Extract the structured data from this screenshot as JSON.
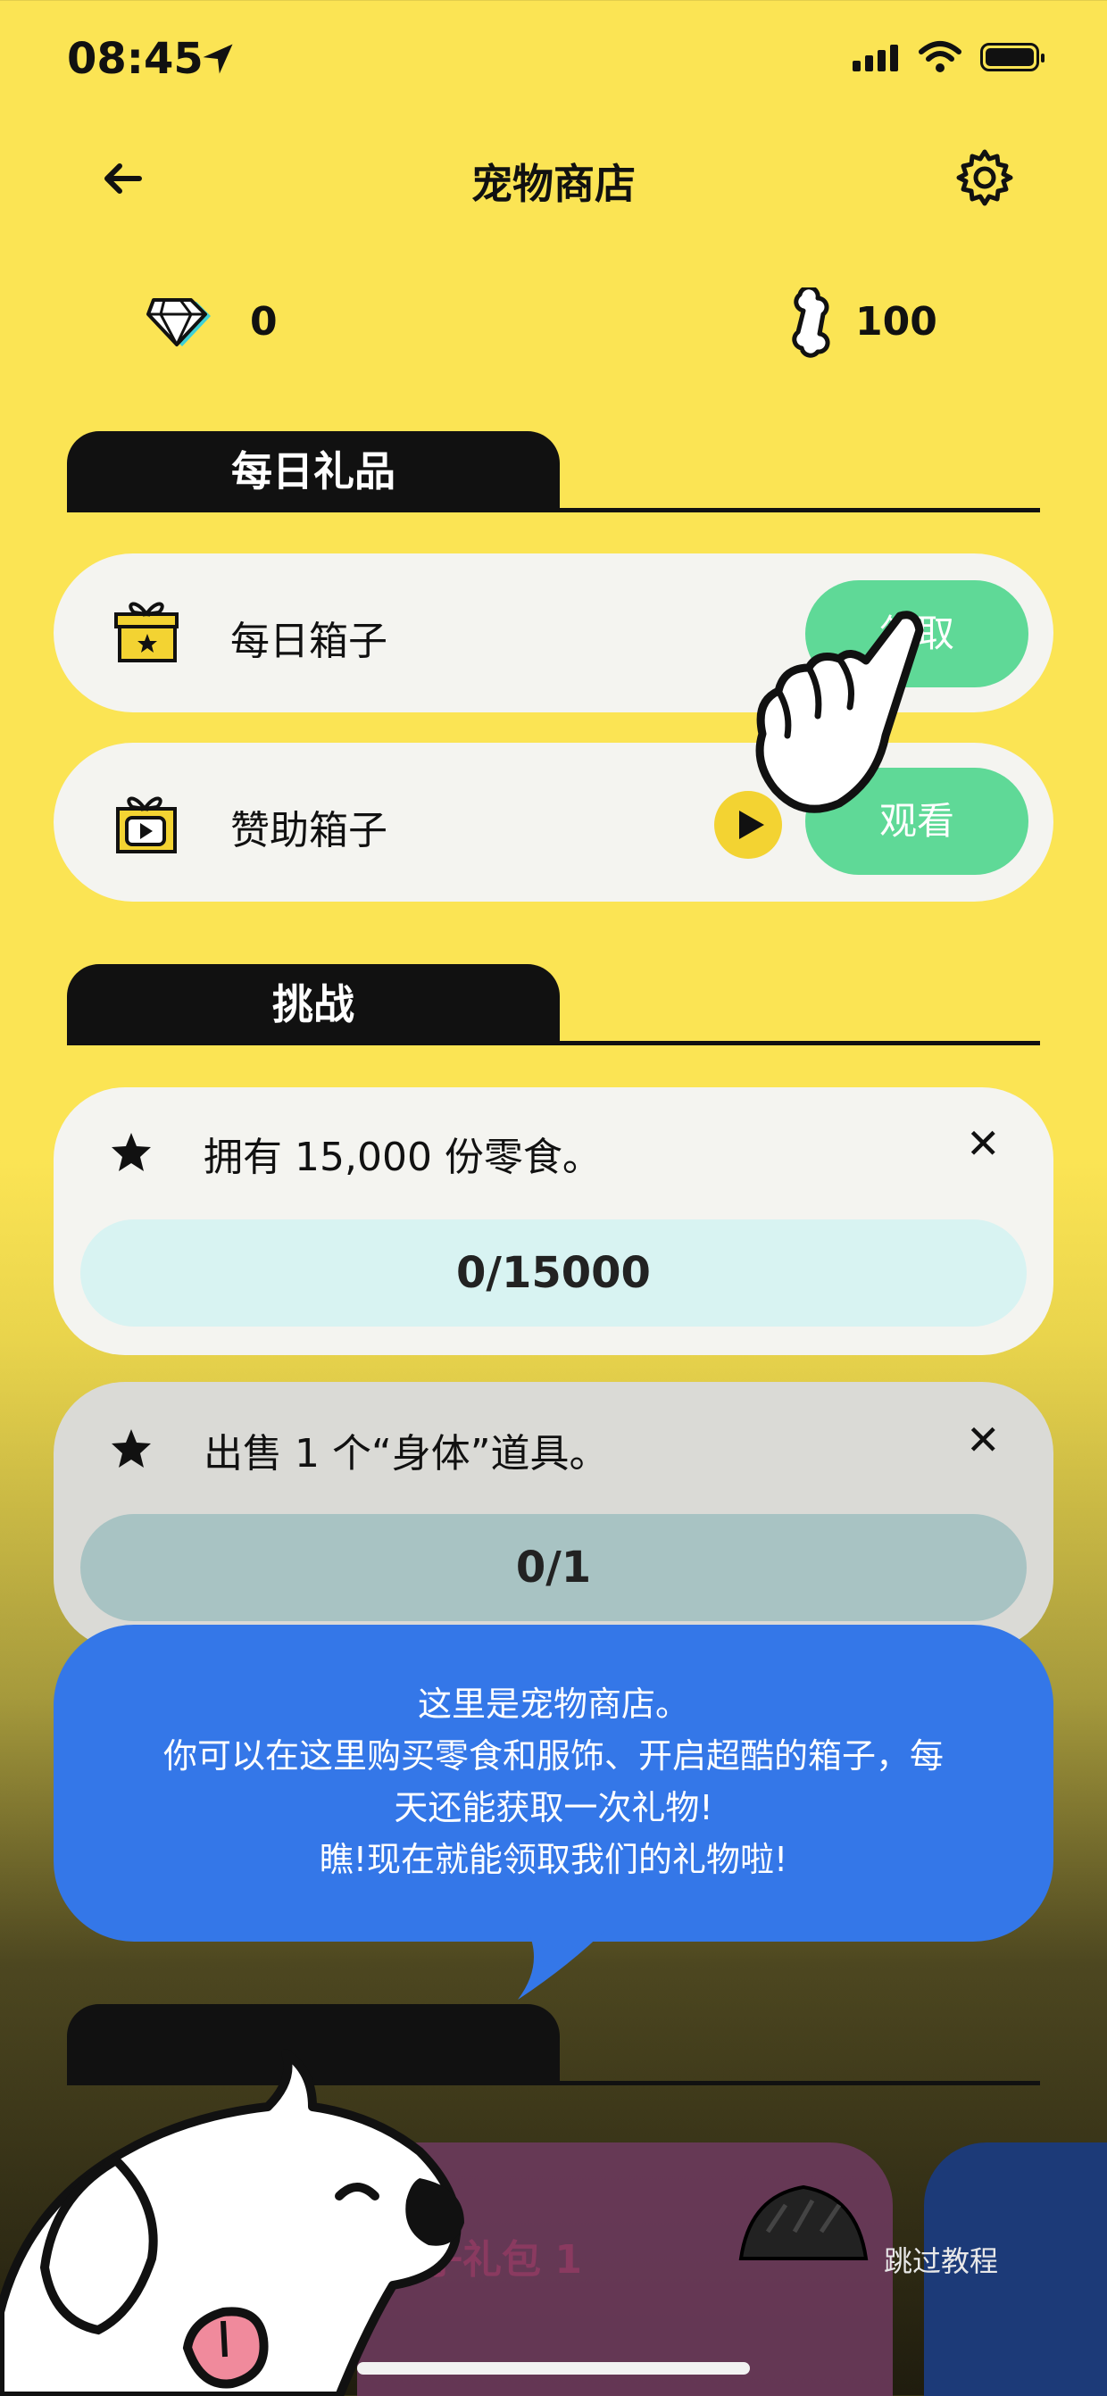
{
  "status_bar": {
    "time": "08:45"
  },
  "header": {
    "title": "宠物商店"
  },
  "currency": {
    "gems": "0",
    "bones": "100"
  },
  "daily_gifts": {
    "section_title": "每日礼品",
    "items": [
      {
        "label": "每日箱子",
        "button": "领取"
      },
      {
        "label": "赞助箱子",
        "button": "观看"
      }
    ]
  },
  "challenges": {
    "section_title": "挑战",
    "items": [
      {
        "text": "拥有 15,000 份零食。",
        "progress": "0/15000"
      },
      {
        "text": "出售 1 个“身体”道具。",
        "progress": "0/1"
      }
    ],
    "close_glyph": "✕"
  },
  "tutorial": {
    "lines": [
      "这里是宠物商店。",
      "你可以在这里购买零食和服饰、开启超酷的箱子，每",
      "天还能获取一次礼物!",
      "瞧!现在就能领取我们的礼物啦!"
    ],
    "skip_label": "跳过教程"
  },
  "pack": {
    "title": "箱子礼包 1"
  },
  "colors": {
    "background": "#fbe454",
    "accent_green": "#5fd997",
    "bubble_blue": "#3477e8",
    "dark": "#111111"
  },
  "icons": [
    "location-arrow-icon",
    "signal-icon",
    "wifi-icon",
    "battery-icon",
    "back-arrow-icon",
    "gear-icon",
    "diamond-icon",
    "bone-icon",
    "gift-box-icon",
    "video-gift-icon",
    "play-icon",
    "star-icon",
    "close-icon",
    "pointing-hand-icon",
    "dog-mascot"
  ]
}
